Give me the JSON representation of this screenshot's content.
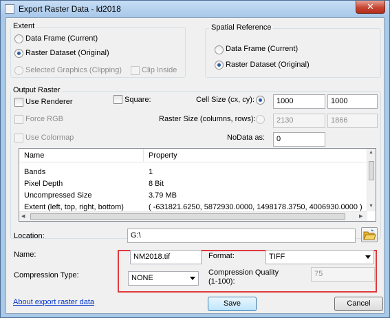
{
  "window": {
    "title": "Export Raster Data - ld2018",
    "close_glyph": "✕"
  },
  "extent": {
    "label": "Extent",
    "data_frame": "Data Frame (Current)",
    "raster_dataset": "Raster Dataset (Original)",
    "selected_graphics": "Selected Graphics (Clipping)",
    "clip_inside": "Clip Inside",
    "selected": "raster_dataset"
  },
  "spatial_reference": {
    "label": "Spatial Reference",
    "data_frame": "Data Frame (Current)",
    "raster_dataset": "Raster Dataset (Original)",
    "selected": "raster_dataset"
  },
  "output_raster": {
    "label": "Output Raster",
    "use_renderer": "Use Renderer",
    "force_rgb": "Force RGB",
    "use_colormap": "Use Colormap",
    "square": "Square:",
    "cell_size_label": "Cell Size (cx, cy):",
    "cell_cx": "1000",
    "cell_cy": "1000",
    "raster_size_label": "Raster Size (columns, rows):",
    "columns": "2130",
    "rows": "1866",
    "nodata_label": "NoData as:",
    "nodata_value": "0"
  },
  "properties": {
    "columns": [
      "Name",
      "Property"
    ],
    "rows": [
      {
        "name": "Bands",
        "value": "1"
      },
      {
        "name": "Pixel Depth",
        "value": "8 Bit"
      },
      {
        "name": "Uncompressed Size",
        "value": "3.79 MB"
      },
      {
        "name": "Extent (left, top, right, bottom)",
        "value": "( -631821.6250, 5872930.0000, 1498178.3750, 4006930.0000 )"
      }
    ]
  },
  "location": {
    "label": "Location:",
    "value": "G:\\"
  },
  "name": {
    "label": "Name:",
    "value": "NM2018.tif"
  },
  "format": {
    "label": "Format:",
    "value": "TIFF"
  },
  "compression_type": {
    "label": "Compression Type:",
    "value": "NONE"
  },
  "compression_quality": {
    "label_line1": "Compression Quality",
    "label_line2": "(1-100):",
    "value": "75"
  },
  "footer": {
    "help_link": "About export raster data",
    "save": "Save",
    "cancel": "Cancel"
  },
  "colors": {
    "highlight_border": "#e0383c",
    "link": "#0033cc",
    "title_bar": "#a8c8ea"
  }
}
